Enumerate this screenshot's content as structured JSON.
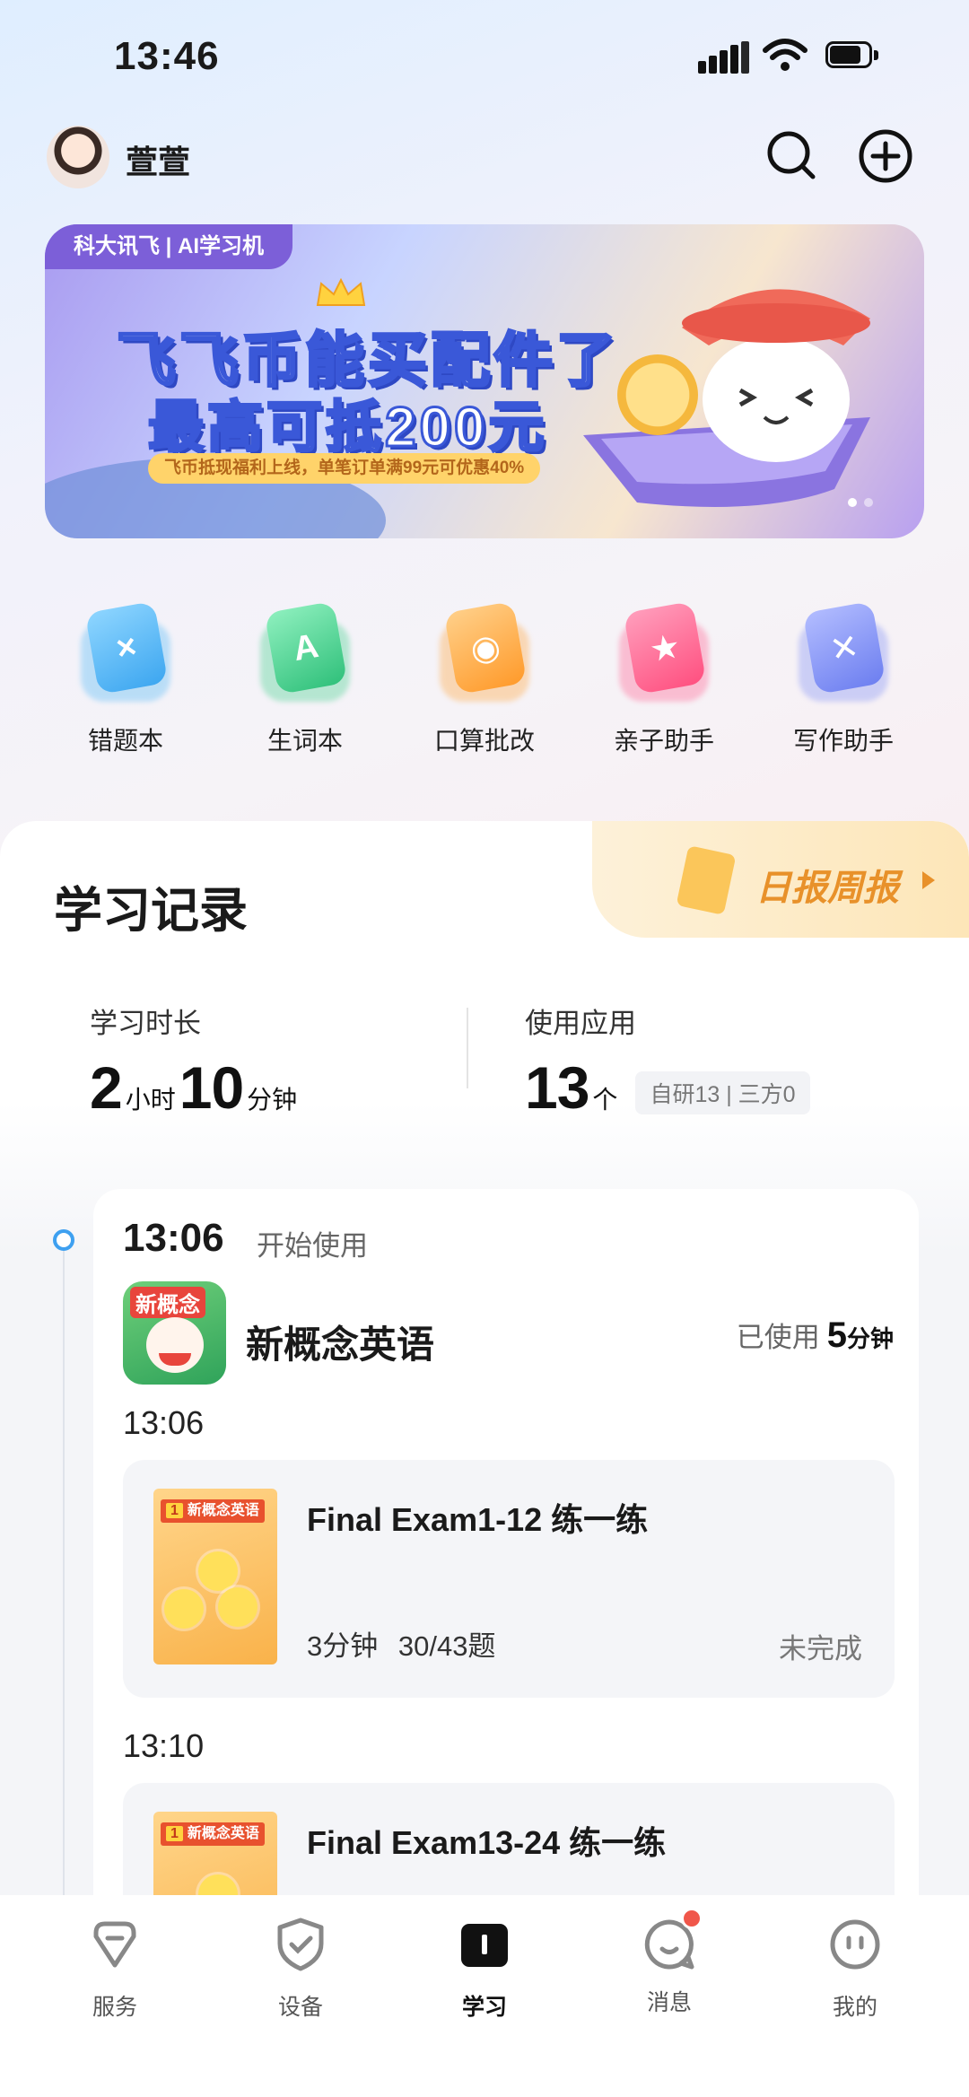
{
  "status": {
    "time": "13:46"
  },
  "header": {
    "username": "萱萱"
  },
  "banner": {
    "brand_tag": "科大讯飞 | AI学习机",
    "headline_1": "飞飞币能买配件了",
    "headline_2": "最高可抵200元",
    "subline": "飞币抵现福利上线，单笔订单满99元可优惠40%"
  },
  "quick_actions": [
    {
      "label": "错题本",
      "color": "#4fb7f5",
      "glyph": "×"
    },
    {
      "label": "生词本",
      "color": "#3fcf8a",
      "glyph": "A"
    },
    {
      "label": "口算批改",
      "color": "#ffa338",
      "glyph": "◉"
    },
    {
      "label": "亲子助手",
      "color": "#ff5c8e",
      "glyph": "★"
    },
    {
      "label": "写作助手",
      "color": "#7b8cf5",
      "glyph": "✕"
    }
  ],
  "record": {
    "title": "学习记录",
    "daily_report": "日报周报",
    "duration_label": "学习时长",
    "duration_hours": "2",
    "hours_unit": "小时",
    "duration_minutes": "10",
    "minutes_unit": "分钟",
    "apps_label": "使用应用",
    "apps_count": "13",
    "apps_unit": "个",
    "apps_breakdown": "自研13 | 三方0"
  },
  "session": {
    "time": "13:06",
    "start_label": "开始使用",
    "app_icon_text": "新概念",
    "app_name": "新概念英语",
    "used_label": "已使用",
    "used_value": "5",
    "used_unit": "分钟",
    "book_badge_num": "1",
    "book_badge_text": "新概念英语",
    "exercises": [
      {
        "time": "13:06",
        "title": "Final Exam1-12 练一练",
        "meta": "3分钟 30/43题",
        "status": "未完成"
      },
      {
        "time": "13:10",
        "title": "Final Exam13-24 练一练",
        "meta": "",
        "status": ""
      }
    ]
  },
  "tabbar": [
    {
      "label": "服务",
      "icon": "diamond-icon"
    },
    {
      "label": "设备",
      "icon": "shield-check-icon"
    },
    {
      "label": "学习",
      "icon": "book-icon"
    },
    {
      "label": "消息",
      "icon": "chat-icon"
    },
    {
      "label": "我的",
      "icon": "face-icon"
    }
  ]
}
